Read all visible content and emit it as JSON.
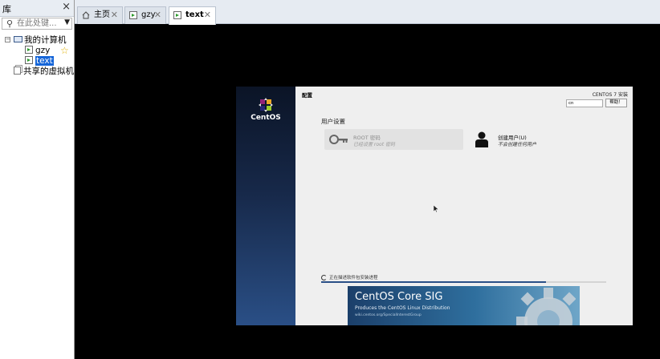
{
  "library": {
    "title": "库",
    "search_placeholder": "在此处键...",
    "tree": {
      "my_computer": "我的计算机",
      "vms": [
        {
          "name": "gzy",
          "favorite": true
        },
        {
          "name": "text",
          "selected": true
        }
      ],
      "shared": "共享的虚拟机"
    }
  },
  "tabs": [
    {
      "label": "主页",
      "icon": "home-icon",
      "active": false
    },
    {
      "label": "gzy",
      "icon": "vm-icon",
      "active": false
    },
    {
      "label": "text",
      "icon": "vm-icon",
      "active": true
    }
  ],
  "guest": {
    "brand": "CentOS",
    "config_title": "配置",
    "install_title": "CENTOS 7 安装",
    "language": "cn",
    "help_label": "帮助！",
    "user_settings": "用户设置",
    "root_spoke": {
      "name": "ROOT 密码",
      "status": "已经设置 root 密码"
    },
    "user_spoke": {
      "name": "创建用户(U)",
      "status": "不会创建任何用户"
    },
    "progress_text": "正在描述软件包安装进程",
    "progress_fraction": 0.79,
    "banner": {
      "title": "CentOS Core SIG",
      "subtitle": "Produces the CentOS Linux Distribution",
      "url": "wiki.centos.org/SpecialInterestGroup"
    }
  },
  "colors": {
    "selection": "#1565d8",
    "guest_sidebar": "#17294a",
    "star": "#e0b000"
  }
}
